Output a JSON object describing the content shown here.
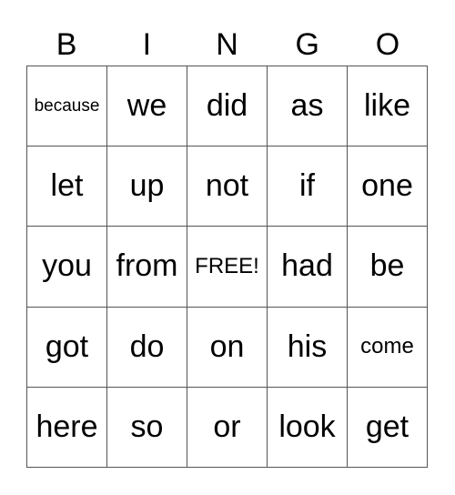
{
  "header": [
    "B",
    "I",
    "N",
    "G",
    "O"
  ],
  "rows": [
    [
      {
        "text": "because",
        "size": "small"
      },
      {
        "text": "we"
      },
      {
        "text": "did"
      },
      {
        "text": "as"
      },
      {
        "text": "like"
      }
    ],
    [
      {
        "text": "let"
      },
      {
        "text": "up"
      },
      {
        "text": "not"
      },
      {
        "text": "if"
      },
      {
        "text": "one"
      }
    ],
    [
      {
        "text": "you"
      },
      {
        "text": "from"
      },
      {
        "text": "FREE!",
        "size": "free"
      },
      {
        "text": "had"
      },
      {
        "text": "be"
      }
    ],
    [
      {
        "text": "got"
      },
      {
        "text": "do"
      },
      {
        "text": "on"
      },
      {
        "text": "his"
      },
      {
        "text": "come",
        "size": "mid"
      }
    ],
    [
      {
        "text": "here"
      },
      {
        "text": "so"
      },
      {
        "text": "or"
      },
      {
        "text": "look"
      },
      {
        "text": "get"
      }
    ]
  ]
}
